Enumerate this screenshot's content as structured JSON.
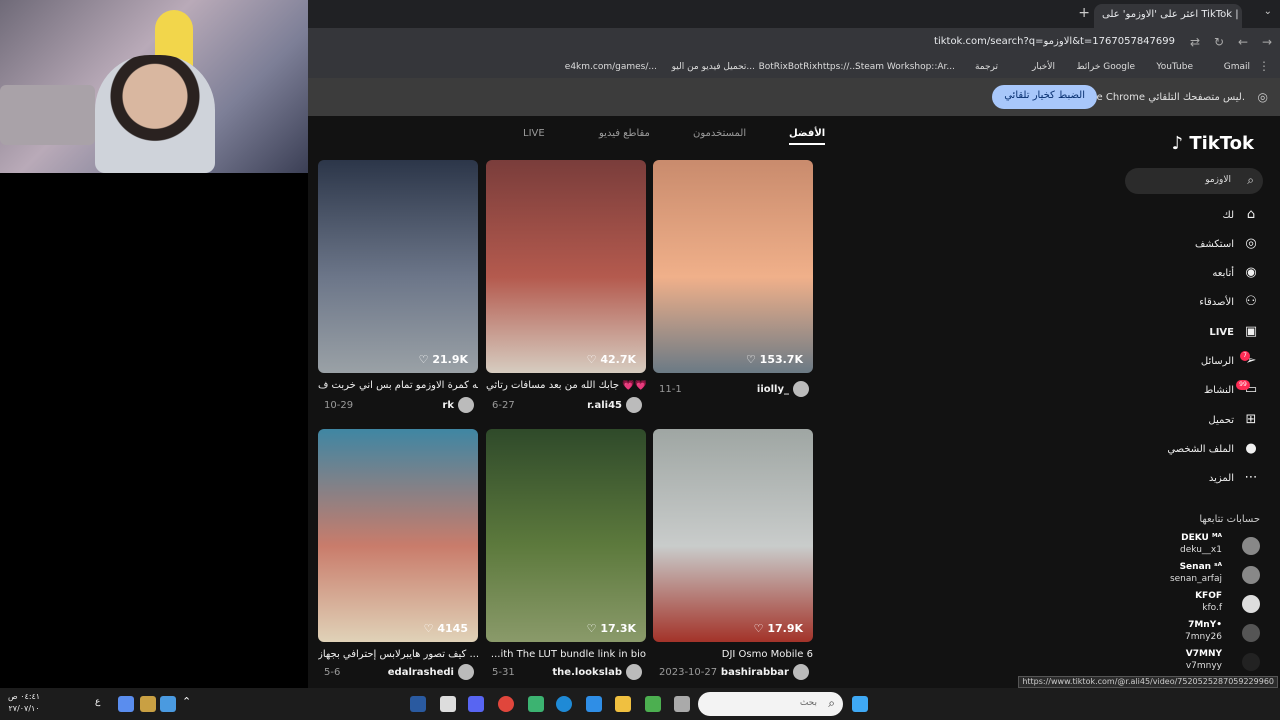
{
  "browser": {
    "tab_title": "اعثر على 'الاوزمو' على TikTok | ب...",
    "url": "tiktok.com/search?q=الاوزمو&t=1767057847699",
    "bookmarks": [
      "Gmail",
      "YouTube",
      "خرائط Google",
      "الأخبار",
      "ترجمة",
      "Steam Workshop::Ar...",
      "BotRixBotRixhttps://...",
      "تحميل فيديو من اليو...",
      "e4km.com/games/..."
    ],
    "infobar_text": "Google Chrome ليس متصفحك التلقائي.",
    "infobar_button": "الضبط كخيار تلقائي",
    "status_url": "https://www.tiktok.com/@r.ali45/video/7520525287059229960"
  },
  "tiktok": {
    "logo": "TikTok",
    "search_value": "الاوزمو",
    "tabs": [
      "الأفضل",
      "المستخدمون",
      "مقاطع فيديو",
      "LIVE"
    ],
    "nav": [
      {
        "label": "لك",
        "icon": "home-icon"
      },
      {
        "label": "استكشف",
        "icon": "compass-icon"
      },
      {
        "label": "أتابعه",
        "icon": "following-icon"
      },
      {
        "label": "الأصدقاء",
        "icon": "friends-icon"
      },
      {
        "label": "LIVE",
        "icon": "live-icon"
      },
      {
        "label": "الرسائل",
        "icon": "messages-icon",
        "badge": "7"
      },
      {
        "label": "النشاط",
        "icon": "activity-icon",
        "badge": "99"
      },
      {
        "label": "تحميل",
        "icon": "upload-icon"
      },
      {
        "label": "الملف الشخصي",
        "icon": "profile-icon"
      },
      {
        "label": "المزيد",
        "icon": "more-icon"
      }
    ],
    "following_title": "حسابات تتابعها",
    "following": [
      {
        "name": "DEKU ᴹᴬ",
        "handle": "deku__x1"
      },
      {
        "name": "Senan ˢᴬ",
        "handle": "senan_arfaj"
      },
      {
        "name": "KFOF",
        "handle": "kfo.f"
      },
      {
        "name": "7MnY•",
        "handle": "7mny26"
      },
      {
        "name": "V7MNY",
        "handle": "v7mnyy"
      }
    ],
    "videos": [
      {
        "likes": "153.7K",
        "caption": "",
        "author": "iiolly_",
        "date": "11-1",
        "colors": [
          "#c98b6d",
          "#f0b08a",
          "#6b7a85"
        ]
      },
      {
        "likes": "42.7K",
        "caption": "جابك الله من بعد مسافات رتاثي 💗💗 ...",
        "author": "r.ali45",
        "date": "6-27",
        "colors": [
          "#7a3d3b",
          "#b45a4e",
          "#d6ccc0"
        ]
      },
      {
        "likes": "21.9K",
        "caption": "والله كمرة الاوزمو تمام بس اني خربت ف...",
        "author": "rk",
        "date": "10-29",
        "colors": [
          "#2c3649",
          "#6c7689",
          "#9aa1a6"
        ]
      },
      {
        "likes": "17.9K",
        "caption": "DJI Osmo Mobile 6",
        "author": "bashirabbar",
        "date": "2023-10-27",
        "colors": [
          "#9fa6a3",
          "#c9cccb",
          "#a33329"
        ]
      },
      {
        "likes": "17.3K",
        "caption": "...ith The LUT bundle link in bio",
        "author": "the.lookslab",
        "date": "5-31",
        "colors": [
          "#2f4a2a",
          "#5d7a3d",
          "#8a9a6a"
        ]
      },
      {
        "likes": "4145",
        "caption": "كيف تصور هايبرلابس إحترافي بجهاز ...",
        "author": "edalrashedi",
        "date": "5-6",
        "colors": [
          "#3f86a3",
          "#c97c6b",
          "#e0d2b8"
        ]
      }
    ]
  },
  "taskbar": {
    "search_placeholder": "بحث",
    "time": "٠٤:٤١ ص",
    "date": "٢٧/٠٧/١٠",
    "lang": "ع"
  }
}
